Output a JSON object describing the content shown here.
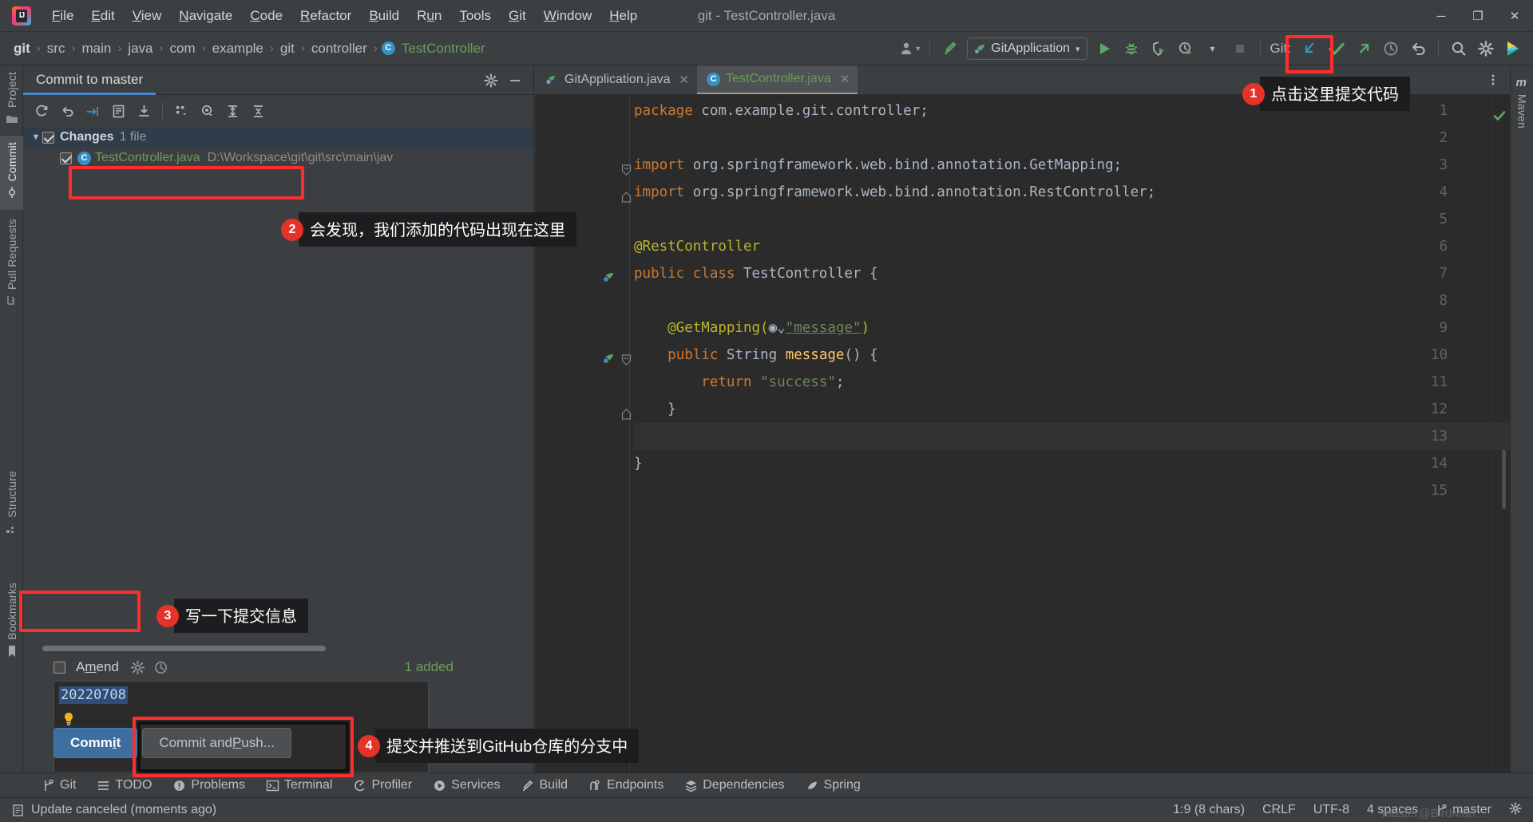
{
  "window": {
    "title": "git - TestController.java",
    "minimize": "─",
    "maximize": "❐",
    "close": "✕"
  },
  "menu": {
    "items": [
      {
        "label": "File",
        "mnemonic": "F"
      },
      {
        "label": "Edit",
        "mnemonic": "E"
      },
      {
        "label": "View",
        "mnemonic": "V"
      },
      {
        "label": "Navigate",
        "mnemonic": "N"
      },
      {
        "label": "Code",
        "mnemonic": "C"
      },
      {
        "label": "Refactor",
        "mnemonic": "R"
      },
      {
        "label": "Build",
        "mnemonic": "B"
      },
      {
        "label": "Run",
        "mnemonic": "u"
      },
      {
        "label": "Tools",
        "mnemonic": "T"
      },
      {
        "label": "Git",
        "mnemonic": "G"
      },
      {
        "label": "Window",
        "mnemonic": "W"
      },
      {
        "label": "Help",
        "mnemonic": "H"
      }
    ]
  },
  "navbar": {
    "breadcrumbs": [
      "git",
      "src",
      "main",
      "java",
      "com",
      "example",
      "git",
      "controller"
    ],
    "current_class": "TestController",
    "class_icon_letter": "C",
    "run_config": "GitApplication",
    "git_label": "Git:",
    "icons": [
      "user-avatar-icon",
      "build-hammer-icon",
      "run-icon",
      "debug-icon",
      "run-coverage-icon",
      "profile-icon",
      "stop-icon",
      "git-update-icon",
      "git-commit-icon",
      "git-push-icon",
      "git-history-icon",
      "git-rollback-icon",
      "search-everywhere-icon",
      "settings-icon",
      "ide-plugin-icon"
    ]
  },
  "left_tool_strip": {
    "items": [
      {
        "label": "Project",
        "icon": "project-folder-icon",
        "active": false
      },
      {
        "label": "Commit",
        "icon": "commit-icon",
        "active": true
      },
      {
        "label": "Pull Requests",
        "icon": "pull-request-icon",
        "active": false
      },
      {
        "label": "Structure",
        "icon": "structure-icon",
        "active": false
      },
      {
        "label": "Bookmarks",
        "icon": "bookmark-icon",
        "active": false
      }
    ]
  },
  "right_tool_strip": {
    "items": [
      {
        "label": "Maven",
        "icon": "maven-icon"
      }
    ]
  },
  "commit_window": {
    "title": "Commit to master",
    "toolbar_icons": [
      "refresh-icon",
      "rollback-icon",
      "shelve-icon",
      "diff-icon",
      "download-icon",
      "group-by-icon",
      "preview-diff-icon",
      "expand-all-icon",
      "collapse-all-icon"
    ],
    "head_icons": [
      "gear-icon",
      "hide-icon"
    ],
    "changes_node": {
      "label": "Changes",
      "count": "1 file",
      "checked": true,
      "expanded": true
    },
    "files": [
      {
        "name": "TestController.java",
        "path": "D:\\Workspace\\git\\git\\src\\main\\jav",
        "checked": true,
        "icon_letter": "C"
      }
    ],
    "amend_label": "Amend",
    "amend_checked": false,
    "amend_icons": [
      "gear-icon",
      "history-icon"
    ],
    "added_label": "1 added",
    "commit_message": "20220708",
    "buttons": {
      "commit": "Commit",
      "commit_and_push": "Commit and Push..."
    }
  },
  "editor": {
    "tabs": [
      {
        "name": "GitApplication.java",
        "icon": "spring-boot-class-icon",
        "active": false,
        "close": "✕"
      },
      {
        "name": "TestController.java",
        "icon": "java-class-icon",
        "active": true,
        "close": "✕"
      }
    ],
    "more_icon": "more-vertical-icon",
    "inspection_status": "ok-check-icon",
    "lines": [
      {
        "n": 1,
        "tokens": [
          {
            "t": "package ",
            "c": "kw"
          },
          {
            "t": "com.example.git.controller;",
            "c": "plain"
          }
        ]
      },
      {
        "n": 2,
        "tokens": []
      },
      {
        "n": 3,
        "fold": "-",
        "tokens": [
          {
            "t": "import ",
            "c": "kw"
          },
          {
            "t": "org.springframework.web.bind.annotation.",
            "c": "plain"
          },
          {
            "t": "GetMapping;",
            "c": "cls2"
          }
        ]
      },
      {
        "n": 4,
        "fold": "^",
        "tokens": [
          {
            "t": "import ",
            "c": "kw"
          },
          {
            "t": "org.springframework.web.bind.annotation.",
            "c": "plain"
          },
          {
            "t": "RestController;",
            "c": "cls2"
          }
        ]
      },
      {
        "n": 5,
        "tokens": []
      },
      {
        "n": 6,
        "tokens": [
          {
            "t": "@RestController",
            "c": "ann"
          }
        ]
      },
      {
        "n": 7,
        "gutter_icon": "spring-bean-icon",
        "tokens": [
          {
            "t": "public class ",
            "c": "kw"
          },
          {
            "t": "TestController",
            "c": "plain"
          },
          {
            "t": " {",
            "c": "plain"
          }
        ]
      },
      {
        "n": 8,
        "tokens": []
      },
      {
        "n": 9,
        "tokens": [
          {
            "t": "    @GetMapping(",
            "c": "ann"
          },
          {
            "t": "◉⌄",
            "c": "plain"
          },
          {
            "t": "\"message\"",
            "c": "urlstr"
          },
          {
            "t": ")",
            "c": "ann"
          }
        ]
      },
      {
        "n": 10,
        "gutter_icon": "spring-endpoint-icon",
        "fold": "-",
        "tokens": [
          {
            "t": "    ",
            "c": "plain"
          },
          {
            "t": "public ",
            "c": "kw"
          },
          {
            "t": "String ",
            "c": "plain"
          },
          {
            "t": "message",
            "c": "mname"
          },
          {
            "t": "() {",
            "c": "plain"
          }
        ]
      },
      {
        "n": 11,
        "tokens": [
          {
            "t": "        ",
            "c": "plain"
          },
          {
            "t": "return ",
            "c": "kw"
          },
          {
            "t": "\"success\"",
            "c": "str"
          },
          {
            "t": ";",
            "c": "plain"
          }
        ]
      },
      {
        "n": 12,
        "fold": "^",
        "tokens": [
          {
            "t": "    }",
            "c": "plain"
          }
        ]
      },
      {
        "n": 13,
        "current": true,
        "tokens": []
      },
      {
        "n": 14,
        "tokens": [
          {
            "t": "}",
            "c": "plain"
          }
        ]
      },
      {
        "n": 15,
        "tokens": []
      }
    ]
  },
  "bottom_tools": {
    "items": [
      {
        "label": "Git",
        "icon": "git-branch-icon"
      },
      {
        "label": "TODO",
        "icon": "todo-list-icon"
      },
      {
        "label": "Problems",
        "icon": "problems-icon"
      },
      {
        "label": "Terminal",
        "icon": "terminal-icon"
      },
      {
        "label": "Profiler",
        "icon": "profiler-icon"
      },
      {
        "label": "Services",
        "icon": "services-icon"
      },
      {
        "label": "Build",
        "icon": "build-icon"
      },
      {
        "label": "Endpoints",
        "icon": "endpoints-icon"
      },
      {
        "label": "Dependencies",
        "icon": "dependencies-icon"
      },
      {
        "label": "Spring",
        "icon": "spring-leaf-icon"
      }
    ]
  },
  "status_bar": {
    "message": "Update canceled (moments ago)",
    "message_icon": "notification-icon",
    "caret": "1:9 (8 chars)",
    "line_separator": "CRLF",
    "encoding": "UTF-8",
    "indent": "4 spaces",
    "branch": "master",
    "branch_icon": "git-branch-icon",
    "watermark": "master@BirdMan..."
  },
  "annotations": [
    {
      "num": "1",
      "text": "点击这里提交代码"
    },
    {
      "num": "2",
      "text": "会发现，我们添加的代码出现在这里"
    },
    {
      "num": "3",
      "text": "写一下提交信息"
    },
    {
      "num": "4",
      "text": "提交并推送到GitHub仓库的分支中"
    }
  ],
  "colors": {
    "accent_blue": "#4a88c7",
    "green": "#59a869",
    "annotation_red": "#e63329",
    "highlight_red": "#ff2d2d"
  }
}
